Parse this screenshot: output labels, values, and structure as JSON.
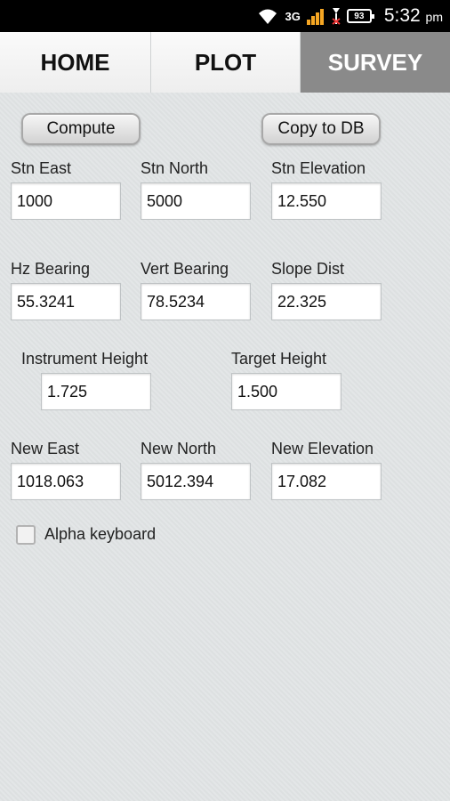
{
  "status_bar": {
    "network": "3G",
    "battery": "93",
    "time": "5:32",
    "ampm": "pm"
  },
  "tabs": [
    {
      "label": "HOME"
    },
    {
      "label": "PLOT"
    },
    {
      "label": "SURVEY"
    }
  ],
  "buttons": {
    "compute": "Compute",
    "copy_to_db": "Copy to DB"
  },
  "station": {
    "east_label": "Stn East",
    "east_value": "1000",
    "north_label": "Stn North",
    "north_value": "5000",
    "elev_label": "Stn Elevation",
    "elev_value": "12.550"
  },
  "observation": {
    "hz_label": "Hz Bearing",
    "hz_value": "55.3241",
    "vert_label": "Vert Bearing",
    "vert_value": "78.5234",
    "slope_label": "Slope Dist",
    "slope_value": "22.325"
  },
  "heights": {
    "instrument_label": "Instrument Height",
    "instrument_value": "1.725",
    "target_label": "Target Height",
    "target_value": "1.500"
  },
  "result": {
    "east_label": "New East",
    "east_value": "1018.063",
    "north_label": "New North",
    "north_value": "5012.394",
    "elev_label": "New Elevation",
    "elev_value": "17.082"
  },
  "options": {
    "alpha_keyboard_label": "Alpha keyboard"
  }
}
